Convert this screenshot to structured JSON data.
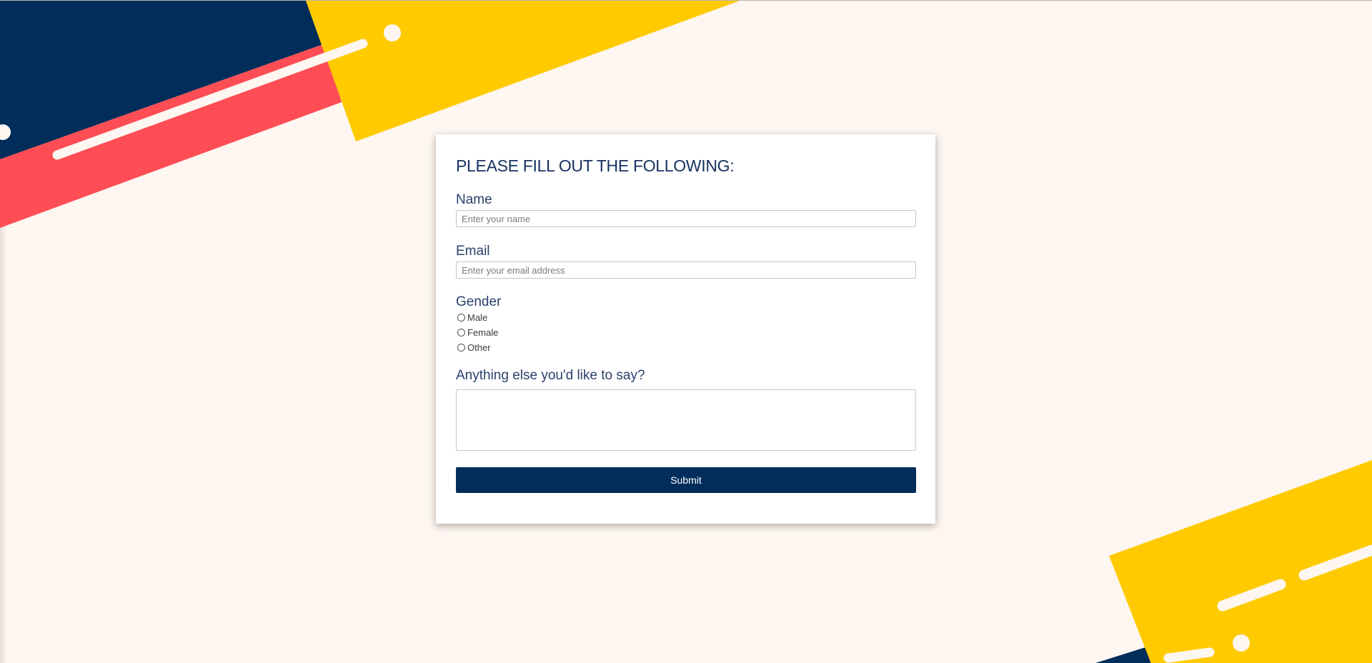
{
  "colors": {
    "background": "#fdf6f1",
    "navy": "#002d5a",
    "coral": "#ff4d55",
    "yellow": "#ffcb00",
    "cream": "#fdf6f1"
  },
  "form": {
    "title": "PLEASE FILL OUT THE FOLLOWING:",
    "name": {
      "label": "Name",
      "placeholder": "Enter your name",
      "value": ""
    },
    "email": {
      "label": "Email",
      "placeholder": "Enter your email address",
      "value": ""
    },
    "gender": {
      "label": "Gender",
      "options": [
        "Male",
        "Female",
        "Other"
      ]
    },
    "message": {
      "label": "Anything else you'd like to say?",
      "value": ""
    },
    "submit_label": "Submit"
  }
}
